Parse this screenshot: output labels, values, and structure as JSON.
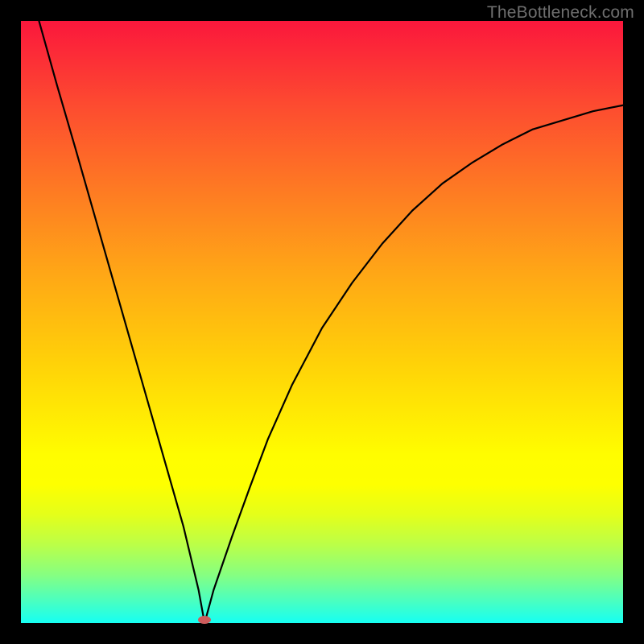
{
  "watermark": "TheBottleneck.com",
  "chart_data": {
    "type": "line",
    "title": "",
    "xlabel": "",
    "ylabel": "",
    "xlim": [
      0,
      1
    ],
    "ylim": [
      0,
      1
    ],
    "grid": false,
    "legend": false,
    "notes": "Valley-shaped curve over a red→green vertical gradient. Values below are (x, y) pairs normalized to the plot area, where y=0 is the bottom green edge and y=1 is the top red edge.",
    "series": [
      {
        "name": "curve",
        "x": [
          0.03,
          0.06,
          0.09,
          0.12,
          0.15,
          0.18,
          0.21,
          0.24,
          0.27,
          0.295,
          0.305,
          0.32,
          0.35,
          0.38,
          0.41,
          0.45,
          0.5,
          0.55,
          0.6,
          0.65,
          0.7,
          0.75,
          0.8,
          0.85,
          0.9,
          0.95,
          1.0
        ],
        "y": [
          1.0,
          0.893,
          0.79,
          0.685,
          0.58,
          0.475,
          0.37,
          0.265,
          0.16,
          0.055,
          0.0,
          0.055,
          0.142,
          0.225,
          0.305,
          0.395,
          0.49,
          0.565,
          0.63,
          0.685,
          0.73,
          0.765,
          0.795,
          0.82,
          0.835,
          0.85,
          0.86
        ]
      }
    ],
    "marker": {
      "x": 0.305,
      "y": 0.005,
      "color": "#cd5c5c",
      "shape": "ellipse"
    },
    "gradient_stops": [
      {
        "pos": 0.0,
        "color": "#fb173c"
      },
      {
        "pos": 0.14,
        "color": "#fd4b30"
      },
      {
        "pos": 0.28,
        "color": "#fe7a23"
      },
      {
        "pos": 0.42,
        "color": "#ffa716"
      },
      {
        "pos": 0.57,
        "color": "#ffd208"
      },
      {
        "pos": 0.72,
        "color": "#fffd00"
      },
      {
        "pos": 0.82,
        "color": "#e4ff1a"
      },
      {
        "pos": 0.87,
        "color": "#bbff48"
      },
      {
        "pos": 0.92,
        "color": "#86ff81"
      },
      {
        "pos": 0.96,
        "color": "#4effbc"
      },
      {
        "pos": 1.0,
        "color": "#16fff3"
      }
    ]
  }
}
